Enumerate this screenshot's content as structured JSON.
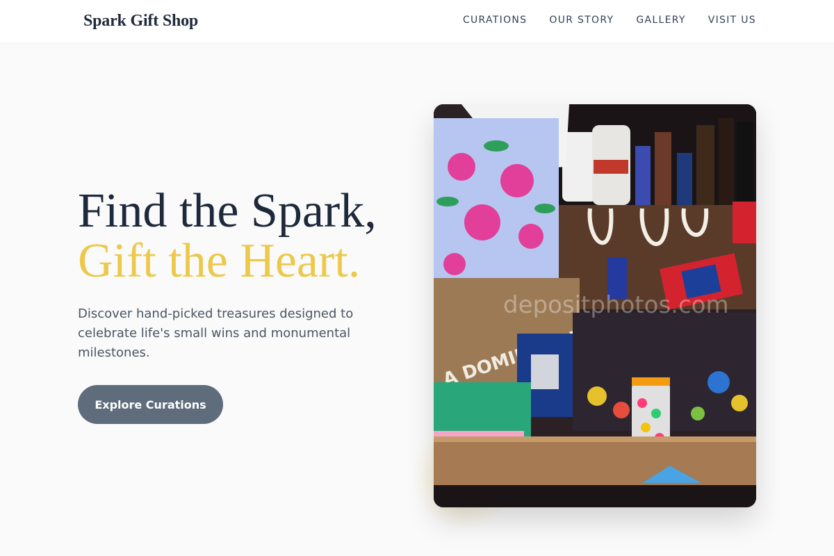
{
  "header": {
    "brand": "Spark Gift Shop",
    "nav": [
      {
        "label": "CURATIONS"
      },
      {
        "label": "OUR STORY"
      },
      {
        "label": "GALLERY"
      },
      {
        "label": "VISIT US"
      }
    ]
  },
  "hero": {
    "title_line1": "Find the Spark,",
    "title_line2": "Gift the Heart.",
    "description": "Discover hand-picked treasures designed to celebrate life's small wins and monumental milestones.",
    "cta_label": "Explore Curations",
    "image_watermark": "depositphotos.com",
    "image_bag_text": "A DOMINICANA"
  },
  "colors": {
    "accent_gold": "#ecc94b",
    "heading_navy": "#1e293b",
    "button_slate": "#5f6c7b",
    "page_bg": "#fafafa"
  }
}
